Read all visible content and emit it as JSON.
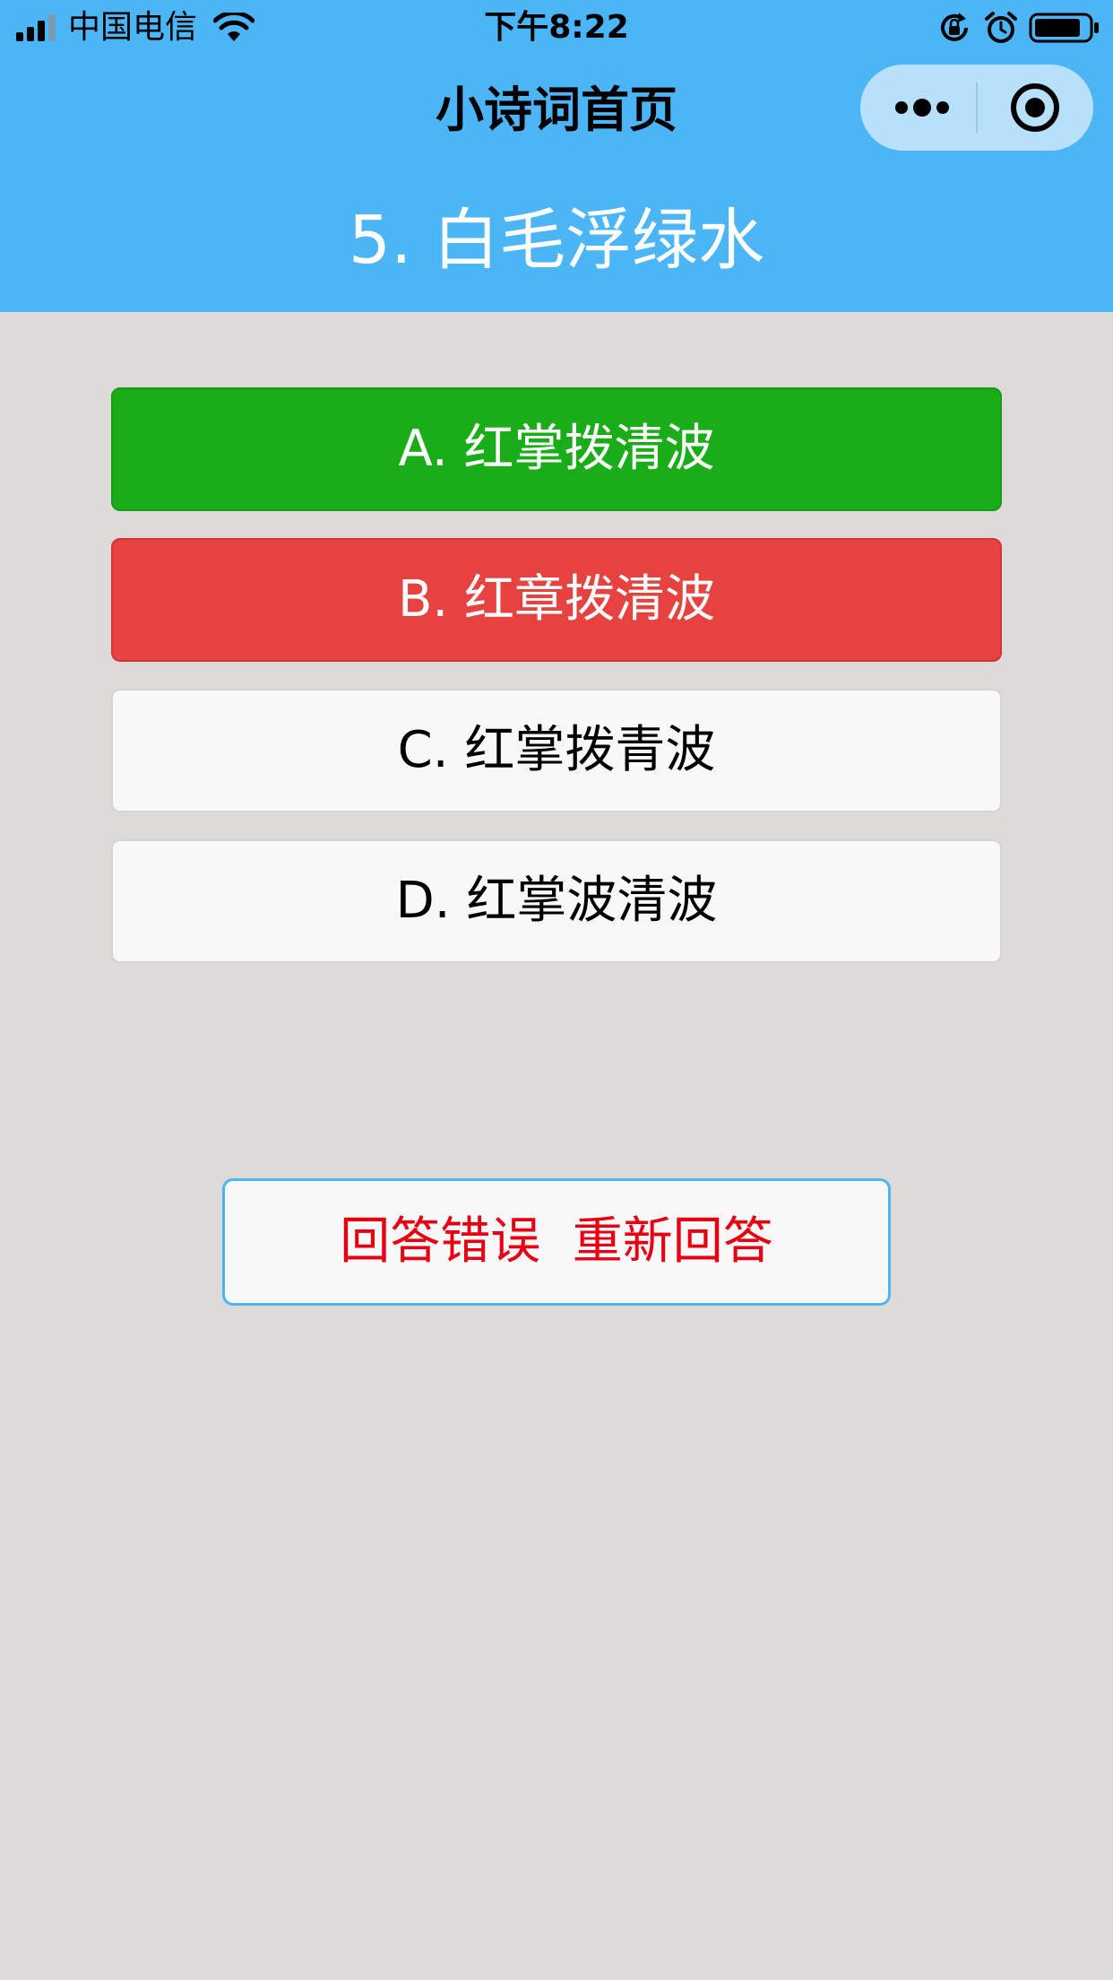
{
  "status_bar": {
    "carrier": "中国电信",
    "time": "下午8:22",
    "icons": [
      "signal-icon",
      "wifi-icon",
      "rotation-lock-icon",
      "alarm-icon",
      "battery-icon"
    ]
  },
  "nav": {
    "title": "小诗词首页",
    "capsule_icons": [
      "more-icon",
      "close-icon"
    ]
  },
  "question": {
    "text": "5. 白毛浮绿水"
  },
  "options": [
    {
      "label": "A. 红掌拨清波",
      "state": "correct",
      "color": "#1aad19"
    },
    {
      "label": "B. 红章拨清波",
      "state": "wrong",
      "color": "#e64340"
    },
    {
      "label": "C. 红掌拨青波",
      "state": "default"
    },
    {
      "label": "D. 红掌波清波",
      "state": "default"
    }
  ],
  "retry": {
    "label": "回答错误  重新回答",
    "color": "#e60012"
  },
  "colors": {
    "header": "#4bb5f6",
    "background": "#dedada"
  }
}
